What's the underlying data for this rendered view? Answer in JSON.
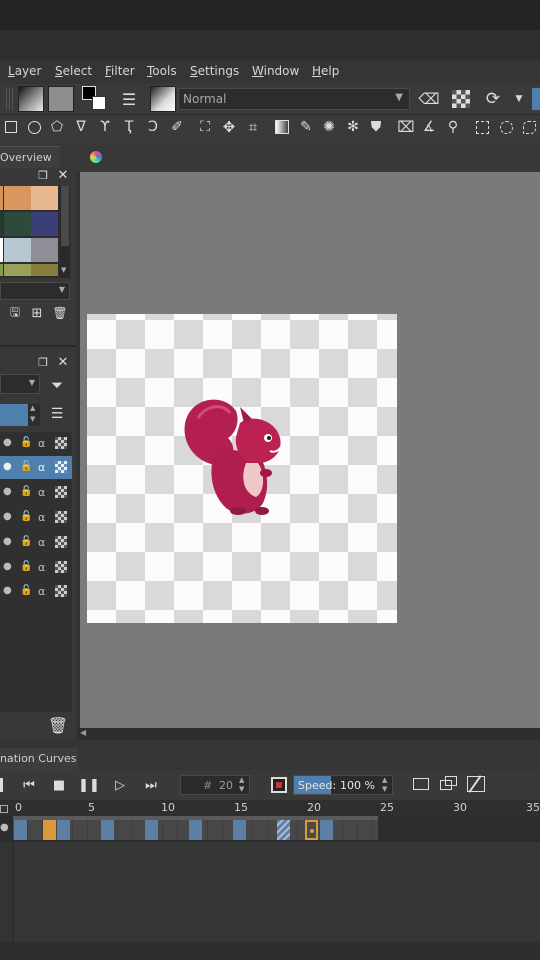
{
  "menu": {
    "items": [
      {
        "label": "Layer"
      },
      {
        "label": "Select"
      },
      {
        "label": "Filter"
      },
      {
        "label": "Tools"
      },
      {
        "label": "Settings"
      },
      {
        "label": "Window"
      },
      {
        "label": "Help"
      }
    ]
  },
  "toolbar": {
    "blend_mode": "Normal"
  },
  "dockers": {
    "overview_tab": "Overview",
    "animation_curves_tab": "nation Curves"
  },
  "palette": {
    "colors": [
      "#d9925a",
      "#d9965e",
      "#e8b890",
      "#263b2c",
      "#2d4a3c",
      "#3b3f78",
      "#b8c8d2",
      "#9aa7b1",
      "#8e8e96",
      "#9aa05a",
      "#7ea04a",
      "#8a7e3e"
    ]
  },
  "timeline": {
    "current_frame": "20",
    "frame_prefix": "#",
    "speed_label": "Speed:",
    "speed_value": "100 %",
    "ruler_ticks": [
      "0",
      "5",
      "10",
      "15",
      "20",
      "25",
      "30",
      "35"
    ]
  },
  "colors": {
    "selection_blue": "#4f7fad",
    "canvas_bg": "#7a7a7a",
    "panel_bg": "#3a3a3a",
    "accent_orange": "#d99a3e"
  }
}
